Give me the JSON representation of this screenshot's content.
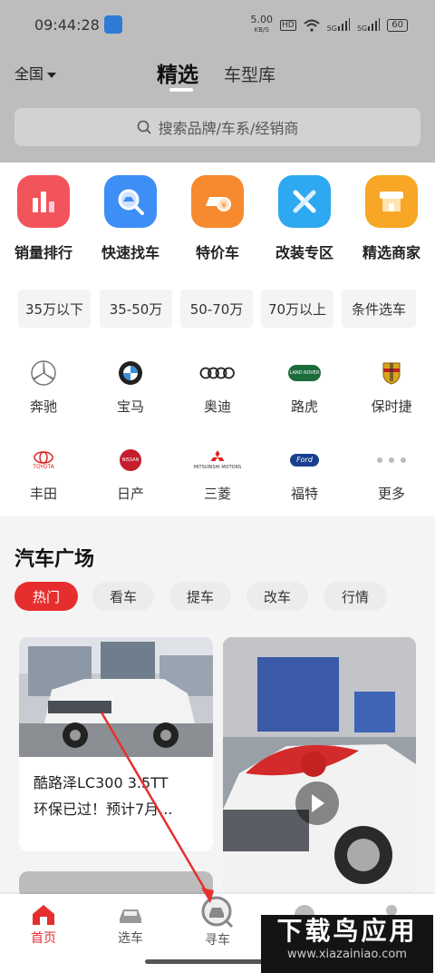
{
  "status": {
    "time": "09:44:28",
    "speed": "5.00",
    "speed_unit": "KB/S",
    "hd": "HD",
    "net1": "5G",
    "net2": "5G",
    "battery": "60"
  },
  "header": {
    "region": "全国",
    "tab_selected": "精选",
    "tab_library": "车型库",
    "search_placeholder": "搜索品牌/车系/经销商"
  },
  "quick": [
    {
      "label": "销量排行",
      "color": "#f2545b",
      "icon": "bar-chart-icon"
    },
    {
      "label": "快速找车",
      "color": "#3d8ef5",
      "icon": "car-search-icon"
    },
    {
      "label": "特价车",
      "color": "#f7892f",
      "icon": "price-tag-car-icon"
    },
    {
      "label": "改装专区",
      "color": "#2ea8f0",
      "icon": "tools-icon"
    },
    {
      "label": "精选商家",
      "color": "#f7a625",
      "icon": "shop-icon"
    }
  ],
  "price_ranges": [
    "35万以下",
    "35-50万",
    "50-70万",
    "70万以上",
    "条件选车"
  ],
  "brands_row1": [
    "奔驰",
    "宝马",
    "奥迪",
    "路虎",
    "保时捷"
  ],
  "brands_row2": [
    "丰田",
    "日产",
    "三菱",
    "福特",
    "更多"
  ],
  "brand_logo_text": {
    "toyota": "TOYOTA",
    "nissan": "NISSAN",
    "mitsubishi": "MITSUBISHI MOTORS",
    "ford": "Ford",
    "landrover": "LAND ROVER"
  },
  "plaza": {
    "title": "汽车广场",
    "chips": [
      "热门",
      "看车",
      "提车",
      "改车",
      "行情"
    ]
  },
  "cards": [
    {
      "line1": "酷路泽LC300 3.5TT",
      "line2": "环保已过！预计7月..."
    }
  ],
  "nav": [
    {
      "label": "首页",
      "icon": "home-icon"
    },
    {
      "label": "选车",
      "icon": "car-icon"
    },
    {
      "label": "寻车",
      "icon": "find-car-icon"
    }
  ],
  "watermark": {
    "title": "下载鸟应用",
    "url": "www.xiazainiao.com"
  },
  "colors": {
    "accent": "#e62e2e",
    "header_bg": "#bdbdbd"
  }
}
